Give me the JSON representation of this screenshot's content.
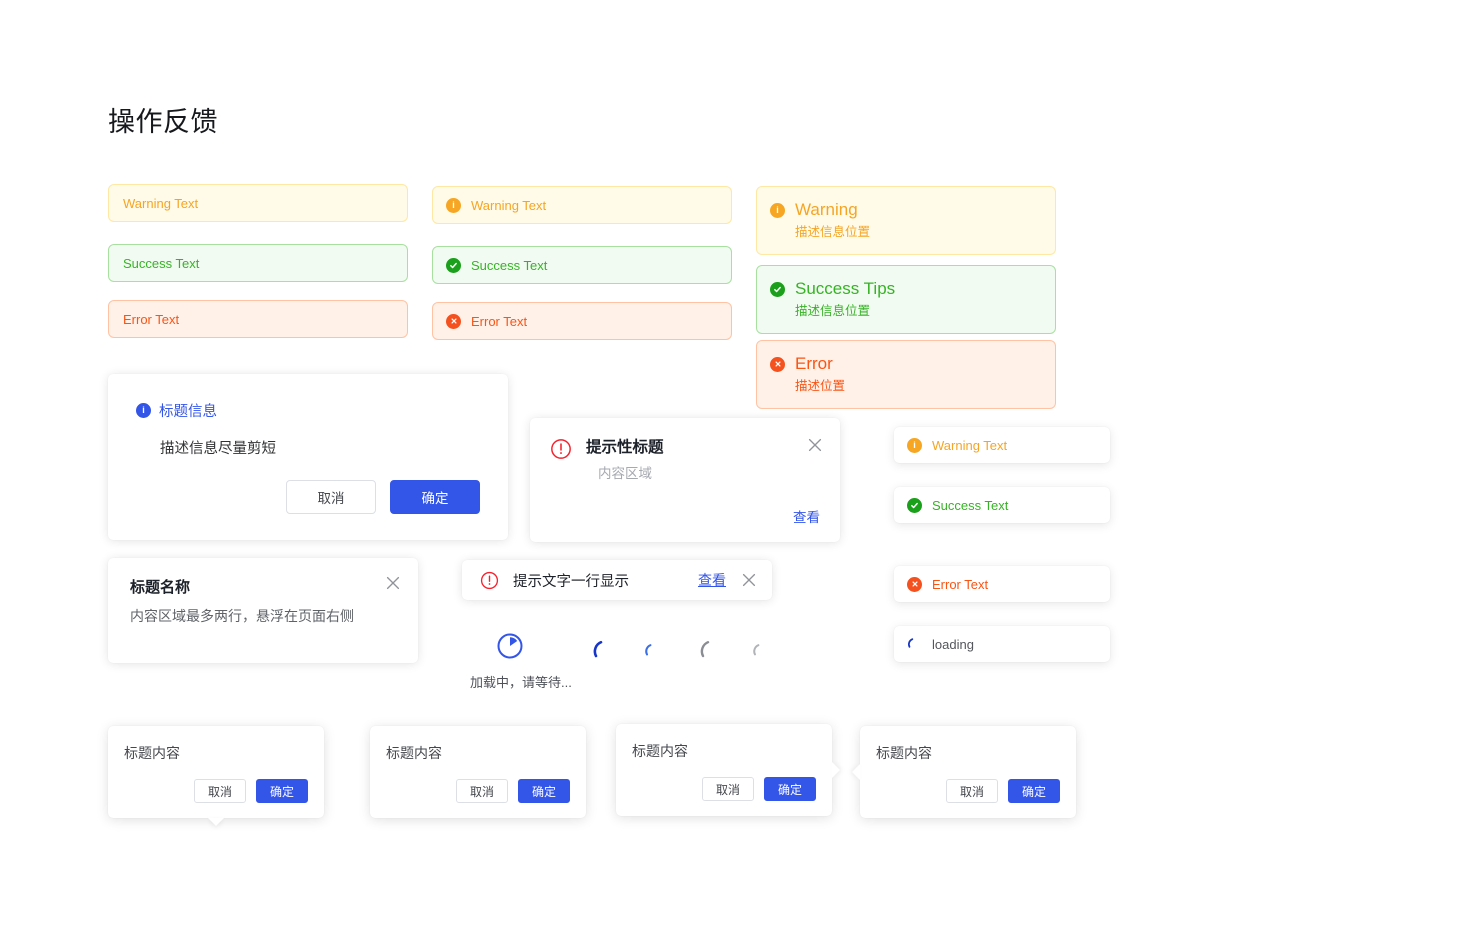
{
  "page": {
    "title": "操作反馈"
  },
  "colors": {
    "warning": "#f5a524",
    "warning_bg": "#fffbe8",
    "warning_border": "#ffe8a3",
    "warning_icon": "#f6a623",
    "success": "#36b325",
    "success_bg": "#f2fbf2",
    "success_border": "#a8e0a0",
    "success_icon": "#1aa01a",
    "error": "#fa5413",
    "error_bg": "#fff0e8",
    "error_border": "#ffc3a3",
    "error_icon": "#f4511e",
    "primary": "#3355e8",
    "danger_outline": "#f5222d",
    "text": "#1d2129",
    "muted": "#a6a9b0"
  },
  "alerts_plain": [
    {
      "label": "Warning Text",
      "type": "warning"
    },
    {
      "label": "Success Text",
      "type": "success"
    },
    {
      "label": "Error Text",
      "type": "error"
    }
  ],
  "alerts_with_icon": [
    {
      "label": "Warning Text",
      "type": "warning",
      "icon": "info-circle-icon"
    },
    {
      "label": "Success Text",
      "type": "success",
      "icon": "check-circle-icon"
    },
    {
      "label": "Error Text",
      "type": "error",
      "icon": "close-circle-icon"
    }
  ],
  "alert_blocks": [
    {
      "title": "Warning",
      "desc": "描述信息位置",
      "type": "warning",
      "icon": "info-circle-icon"
    },
    {
      "title": "Success Tips",
      "desc": "描述信息位置",
      "type": "success",
      "icon": "check-circle-icon"
    },
    {
      "title": "Error",
      "desc": "描述位置",
      "type": "error",
      "icon": "close-circle-icon"
    }
  ],
  "confirm_dialog": {
    "icon": "info-circle-icon",
    "title": "标题信息",
    "body": "描述信息尽量剪短",
    "cancel_label": "取消",
    "ok_label": "确定"
  },
  "notice_card": {
    "icon": "exclamation-circle-outline-icon",
    "title": "提示性标题",
    "desc": "内容区域",
    "link_label": "查看",
    "close_icon": "close-icon"
  },
  "float_card": {
    "title": "标题名称",
    "desc": "内容区域最多两行，悬浮在页面右侧",
    "close_icon": "close-icon"
  },
  "line_toast": {
    "icon": "exclamation-circle-outline-icon",
    "text": "提示文字一行显示",
    "link_label": "查看",
    "close_icon": "close-icon"
  },
  "loading": {
    "label": "加载中，请等待...",
    "main_icon": "clock-spinner-icon",
    "arcs": [
      {
        "name": "spinner-arc-large-blue",
        "color": "#1736c9",
        "size": 26
      },
      {
        "name": "spinner-arc-small-blue",
        "color": "#3b6fe8",
        "size": 18
      },
      {
        "name": "spinner-arc-large-gray",
        "color": "#8a8d93",
        "size": 26
      },
      {
        "name": "spinner-arc-small-gray",
        "color": "#b0b3b8",
        "size": 18
      }
    ]
  },
  "toasts": [
    {
      "label": "Warning Text",
      "type": "warning",
      "icon": "info-circle-icon"
    },
    {
      "label": "Success Text",
      "type": "success",
      "icon": "check-circle-icon"
    },
    {
      "label": "Error Text",
      "type": "error",
      "icon": "close-circle-icon"
    },
    {
      "label": "loading",
      "type": "loading",
      "icon": "spinner-arc-icon"
    }
  ],
  "popovers": [
    {
      "title": "标题内容",
      "cancel_label": "取消",
      "ok_label": "确定",
      "tail": "down"
    },
    {
      "title": "标题内容",
      "cancel_label": "取消",
      "ok_label": "确定",
      "tail": "none"
    },
    {
      "title": "标题内容",
      "cancel_label": "取消",
      "ok_label": "确定",
      "tail": "right"
    },
    {
      "title": "标题内容",
      "cancel_label": "取消",
      "ok_label": "确定",
      "tail": "left"
    }
  ]
}
